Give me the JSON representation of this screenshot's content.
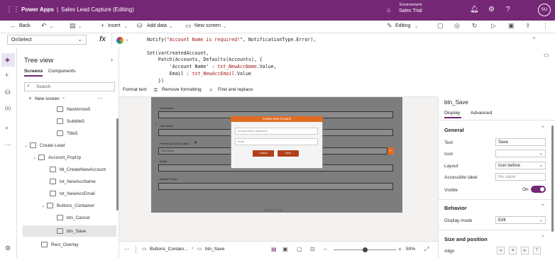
{
  "app": {
    "product": "Power Apps",
    "separator": "|",
    "title": "Sales Lead Capture (Editing)",
    "environment_label": "Environment",
    "environment_name": "Sales Trial",
    "avatar_initials": "SU"
  },
  "toolbar": {
    "back": "Back",
    "insert": "Insert",
    "add_data": "Add data",
    "new_screen": "New screen",
    "editing": "Editing"
  },
  "formula_bar": {
    "property": "OnSelect",
    "fx": "fx"
  },
  "formula_lines": {
    "l1a": "Notify(",
    "l1b": "\"Account Name is required!\"",
    "l1c": ", NotificationType.Error),",
    "l2": "Set(varCreatedAccount,",
    "l3": "    Patch(Accounts, Defaults(Accounts), {",
    "l4a": "        'Account Name' : ",
    "l4b": "txt_NewAccName",
    "l4c": ".Value,",
    "l5a": "        Email : ",
    "l5b": "txt_NewAccEmail",
    "l5c": ".Value",
    "l6": "    })"
  },
  "format_bar": {
    "format_text": "Format text",
    "remove_formatting": "Remove formatting",
    "find_replace": "Find and replace"
  },
  "tree": {
    "title": "Tree view",
    "tab_screens": "Screens",
    "tab_components": "Components",
    "search_placeholder": "Search",
    "new_screen": "New screen",
    "items": [
      "NextArrow5",
      "Subtitle5",
      "Title5",
      "Create Lead",
      "Account_PopUp",
      "lbl_CreateNewAccount",
      "txt_NewAccName",
      "txt_NewAccEmail",
      "Buttons_Container",
      "btn_Cancel",
      "btn_Save",
      "Rect_Overlay"
    ]
  },
  "canvas": {
    "first_name": "First Name",
    "last_name": "Last Name",
    "parent_account": "Parent Account for lead",
    "find_items": "Find items",
    "email": "Email",
    "mobile_phone": "Mobile Phone",
    "save_lead": "Save Lead",
    "popup_title": "Create New Account",
    "popup_name_placeholder": "Account Name (Required)",
    "popup_email_placeholder": "Email",
    "popup_cancel": "Cancel",
    "popup_save": "Save"
  },
  "bottom_bar": {
    "crumb1": "Buttons_Contain...",
    "crumb2": "btn_Save",
    "zoom": "50",
    "zoom_unit": "%",
    "zoom_fraction": 0.5
  },
  "props": {
    "control_name": "btn_Save",
    "tab_display": "Display",
    "tab_advanced": "Advanced",
    "section_general": "General",
    "text_label": "Text",
    "text_value": "Save",
    "icon_label": "Icon",
    "icon_value": "",
    "layout_label": "Layout",
    "layout_value": "Icon before",
    "accessible_label": "Accessible label",
    "accessible_placeholder": "No value",
    "visible_label": "Visible",
    "visible_state": "On",
    "section_behavior": "Behavior",
    "display_mode_label": "Display mode",
    "display_mode_value": "Edit",
    "section_size": "Size and position",
    "align_label": "Align"
  },
  "colors": {
    "brand": "#742774",
    "popup_header": "#e06c21",
    "popup_button": "#b2401d",
    "toggle_on": "#742774"
  }
}
